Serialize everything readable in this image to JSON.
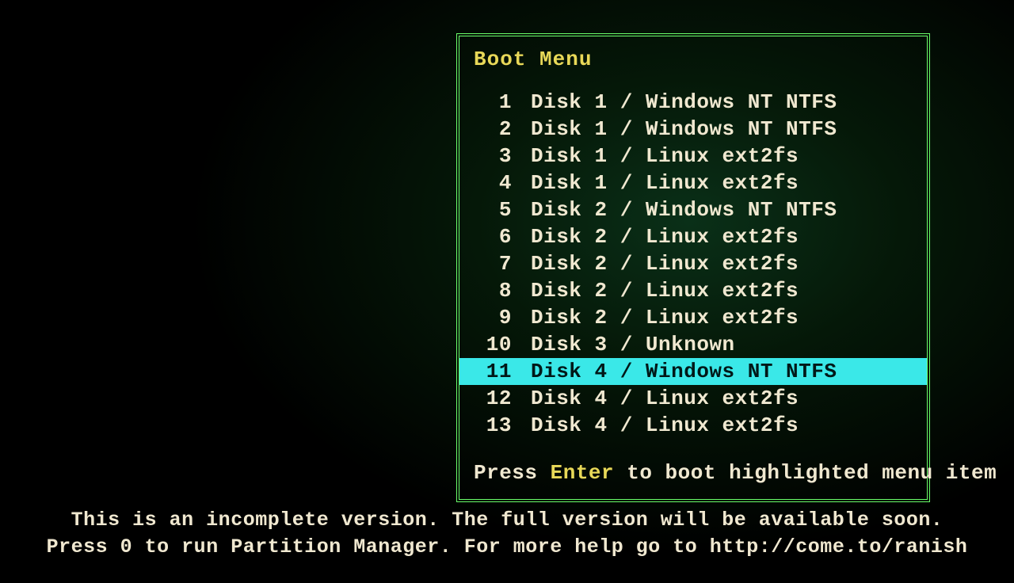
{
  "menu": {
    "title": "Boot Menu",
    "selected_index": 10,
    "items": [
      {
        "num": "1",
        "label": "Disk 1 / Windows NT NTFS"
      },
      {
        "num": "2",
        "label": "Disk 1 / Windows NT NTFS"
      },
      {
        "num": "3",
        "label": "Disk 1 / Linux ext2fs"
      },
      {
        "num": "4",
        "label": "Disk 1 / Linux ext2fs"
      },
      {
        "num": "5",
        "label": "Disk 2 / Windows NT NTFS"
      },
      {
        "num": "6",
        "label": "Disk 2 / Linux ext2fs"
      },
      {
        "num": "7",
        "label": "Disk 2 / Linux ext2fs"
      },
      {
        "num": "8",
        "label": "Disk 2 / Linux ext2fs"
      },
      {
        "num": "9",
        "label": "Disk 2 / Linux ext2fs"
      },
      {
        "num": "10",
        "label": "Disk 3 / Unknown"
      },
      {
        "num": "11",
        "label": "Disk 4 / Windows NT NTFS"
      },
      {
        "num": "12",
        "label": "Disk 4 / Linux ext2fs"
      },
      {
        "num": "13",
        "label": "Disk 4 / Linux ext2fs"
      }
    ],
    "hint_prefix": "Press ",
    "hint_key": "Enter",
    "hint_suffix": " to boot highlighted menu item"
  },
  "footer": {
    "line1": "This is an incomplete version. The full version will be available soon.",
    "line2": "Press 0 to run Partition Manager. For more help go to http://come.to/ranish"
  }
}
